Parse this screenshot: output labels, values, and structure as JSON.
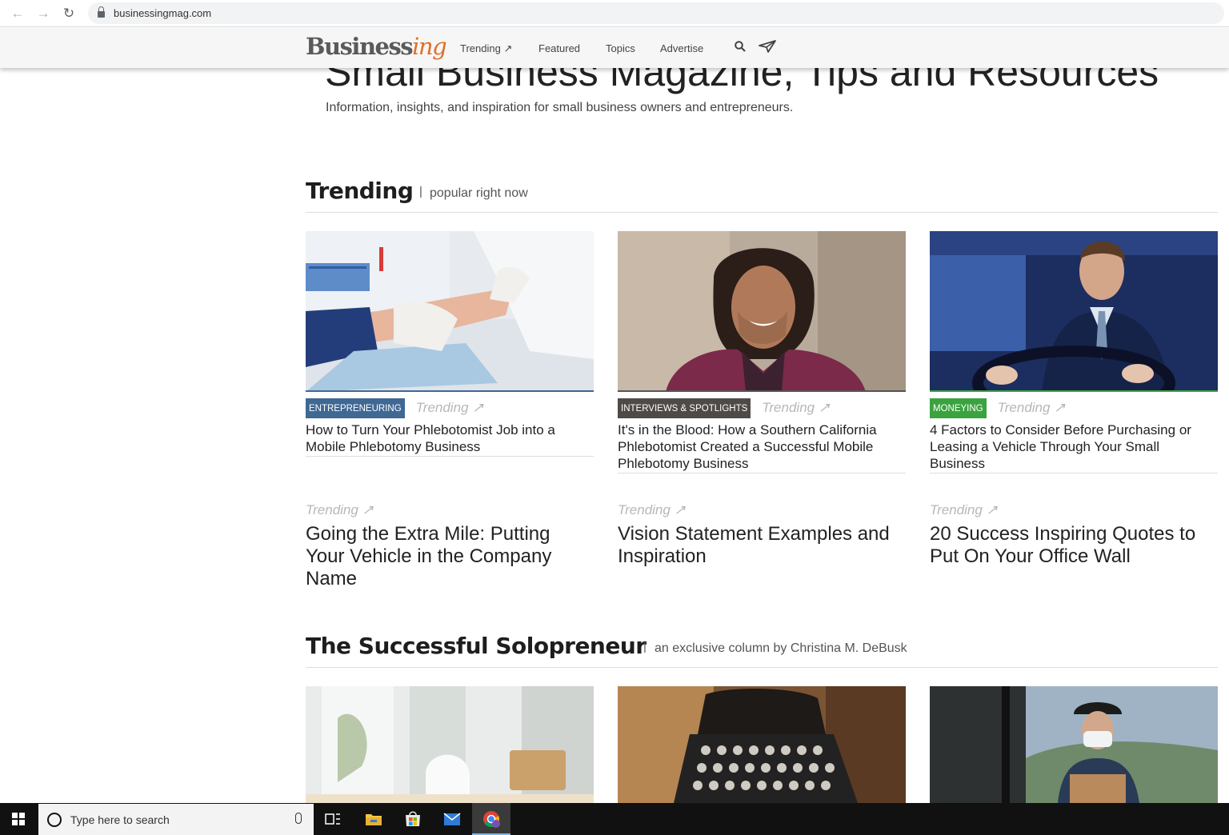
{
  "browser": {
    "back_icon": "arrow-left-icon",
    "forward_icon": "arrow-right-icon",
    "reload_icon": "reload-icon",
    "url": "businessingmag.com"
  },
  "site": {
    "logo_part1": "Business",
    "logo_part2": "ing",
    "logo_color_main": "#5a5a5a",
    "logo_color_accent": "#e06e27",
    "nav": [
      {
        "label": "Trending ↗"
      },
      {
        "label": "Featured"
      },
      {
        "label": "Topics"
      },
      {
        "label": "Advertise"
      }
    ]
  },
  "hero": {
    "title": "Small Business Magazine, Tips and Resources",
    "subtitle": "Information, insights, and inspiration for small business owners and entrepreneurs."
  },
  "trending_section": {
    "title": "Trending",
    "separator": "|",
    "subtitle": "popular right now",
    "trend_label": "Trending ↗",
    "cards": [
      {
        "category": "ENTREPRENEURING",
        "category_color": "#3f6893",
        "title": "How to Turn Your Phlebotomist Job into a Mobile Phlebotomy Business"
      },
      {
        "category": "INTERVIEWS & SPOTLIGHTS",
        "category_color": "#4e4a48",
        "title": "It's in the Blood: How a Southern California Phlebotomist Created a Successful Mobile Phlebotomy Business"
      },
      {
        "category": "MONEYING",
        "category_color": "#3aa33f",
        "title": "4 Factors to Consider Before Purchasing or Leasing a Vehicle Through Your Small Business"
      }
    ],
    "mini": [
      {
        "title": "Going the Extra Mile: Putting Your Vehicle in the Company Name"
      },
      {
        "title": "Vision Statement Examples and Inspiration"
      },
      {
        "title": "20 Success Inspiring Quotes to Put On Your Office Wall"
      }
    ]
  },
  "solo_section": {
    "title": "The Successful Solopreneur",
    "separator": "|",
    "subtitle": "an exclusive column by Christina M. DeBusk"
  },
  "taskbar": {
    "search_placeholder": "Type here to search"
  }
}
